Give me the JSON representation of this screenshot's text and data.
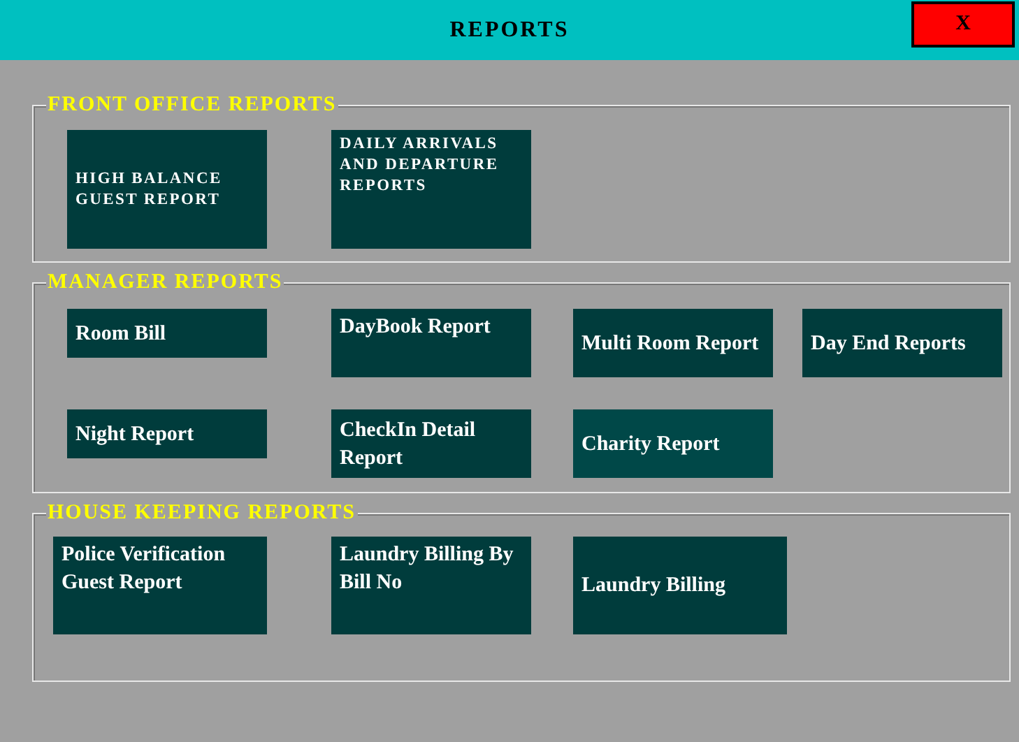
{
  "window": {
    "title": "REPORTS",
    "close_label": "X"
  },
  "sections": [
    {
      "title": "FRONT OFFICE REPORTS",
      "buttons": [
        {
          "label": "HIGH BALANCE GUEST REPORT",
          "highlighted": false
        },
        {
          "label": "DAILY ARRIVALS AND DEPARTURE REPORTS",
          "highlighted": false
        }
      ]
    },
    {
      "title": "MANAGER REPORTS",
      "buttons": [
        {
          "label": "Room Bill",
          "highlighted": false
        },
        {
          "label": "DayBook Report",
          "highlighted": false
        },
        {
          "label": "Multi Room Report",
          "highlighted": false
        },
        {
          "label": "Day End Reports",
          "highlighted": false
        },
        {
          "label": "Night Report",
          "highlighted": false
        },
        {
          "label": "CheckIn Detail Report",
          "highlighted": false
        },
        {
          "label": "Charity Report",
          "highlighted": true
        }
      ]
    },
    {
      "title": "HOUSE KEEPING REPORTS",
      "buttons": [
        {
          "label": "Police Verification Guest Report",
          "highlighted": false
        },
        {
          "label": "Laundry Billing By Bill No",
          "highlighted": false
        },
        {
          "label": "Laundry Billing",
          "highlighted": false
        }
      ]
    }
  ]
}
